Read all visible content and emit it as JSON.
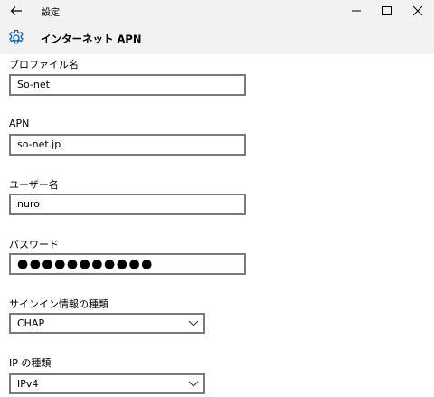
{
  "window": {
    "title": "設定"
  },
  "header": {
    "title": "インターネット APN",
    "icon": "gear-icon"
  },
  "form": {
    "profile_name": {
      "label": "プロファイル名",
      "value": "So-net"
    },
    "apn": {
      "label": "APN",
      "value": "so-net.jp"
    },
    "username": {
      "label": "ユーザー名",
      "value": "nuro"
    },
    "password": {
      "label": "パスワード",
      "value": "●●●●●●●●●●●"
    },
    "signin_type": {
      "label": "サインイン情報の種類",
      "selected": "CHAP"
    },
    "ip_type": {
      "label": "IP の種類",
      "selected": "IPv4"
    }
  },
  "colors": {
    "titlebar_bg": "#f2f2f2",
    "border": "#7a7a7a",
    "accent": "#0063b1"
  }
}
